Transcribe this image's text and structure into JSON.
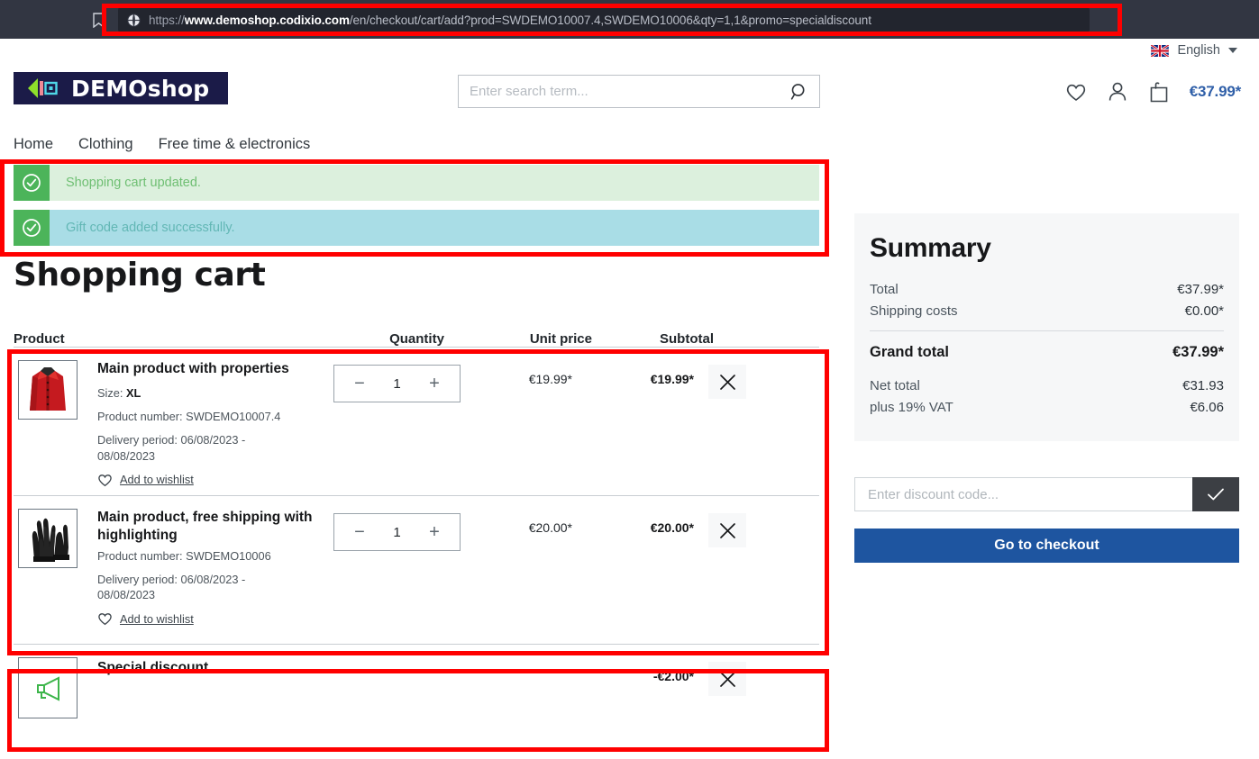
{
  "browser": {
    "bookmark_icon": "bookmark-icon",
    "site_icon": "globe-icon",
    "url_scheme": "https://",
    "url_host": "www.demoshop.codixio.com",
    "url_path": "/en/checkout/cart/add?prod=SWDEMO10007.4,SWDEMO10006&qty=1,1&promo=specialdiscount"
  },
  "header": {
    "language": {
      "flag_icon": "uk-flag-icon",
      "label": "English",
      "caret_icon": "chevron-down-icon"
    },
    "logo": {
      "text": "DEMOshop",
      "mark_icon": "chevron-left-logo-icon"
    },
    "search": {
      "placeholder": "Enter search term...",
      "value": "",
      "icon": "search-icon"
    },
    "actions": {
      "wishlist_icon": "heart-icon",
      "account_icon": "person-icon",
      "cart_icon": "shopping-bag-icon",
      "cart_total": "€37.99*"
    },
    "nav": [
      {
        "label": "Home"
      },
      {
        "label": "Clothing"
      },
      {
        "label": "Free time & electronics"
      }
    ]
  },
  "alerts": [
    {
      "type": "success",
      "icon": "check-circle-icon",
      "text": "Shopping cart updated."
    },
    {
      "type": "info",
      "icon": "check-circle-icon",
      "text": "Gift code added successfully."
    }
  ],
  "page": {
    "title": "Shopping cart"
  },
  "cart": {
    "columns": {
      "product": "Product",
      "quantity": "Quantity",
      "unit_price": "Unit price",
      "subtotal": "Subtotal"
    },
    "items": [
      {
        "thumb_icon": "red-shirt-thumbnail",
        "name": "Main product with properties",
        "variant_label": "Size:",
        "variant_value": "XL",
        "product_number": "Product number: SWDEMO10007.4",
        "delivery_period": "Delivery period: 06/08/2023 - 08/08/2023",
        "wishlist_label": "Add to wishlist",
        "wishlist_icon": "heart-icon",
        "quantity": "1",
        "decrement_label": "−",
        "increment_label": "+",
        "unit_price": "€19.99*",
        "subtotal": "€19.99*",
        "remove_icon": "close-icon"
      },
      {
        "thumb_icon": "black-gloves-thumbnail",
        "name": "Main product, free shipping with highlighting",
        "variant_label": "",
        "variant_value": "",
        "product_number": "Product number: SWDEMO10006",
        "delivery_period": "Delivery period: 06/08/2023 - 08/08/2023",
        "wishlist_label": "Add to wishlist",
        "wishlist_icon": "heart-icon",
        "quantity": "1",
        "decrement_label": "−",
        "increment_label": "+",
        "unit_price": "€20.00*",
        "subtotal": "€20.00*",
        "remove_icon": "close-icon"
      }
    ],
    "discount": {
      "icon": "megaphone-icon",
      "name": "Special discount",
      "subtotal": "-€2.00*",
      "remove_icon": "close-icon"
    }
  },
  "summary": {
    "title": "Summary",
    "lines": [
      {
        "label": "Total",
        "value": "€37.99*"
      },
      {
        "label": "Shipping costs",
        "value": "€0.00*"
      }
    ],
    "grand": {
      "label": "Grand total",
      "value": "€37.99*"
    },
    "tax_lines": [
      {
        "label": "Net total",
        "value": "€31.93"
      },
      {
        "label": "plus 19% VAT",
        "value": "€6.06"
      }
    ]
  },
  "discount_form": {
    "placeholder": "Enter discount code...",
    "value": "",
    "submit_icon": "check-icon"
  },
  "checkout": {
    "label": "Go to checkout"
  },
  "colors": {
    "brand_navy": "#1b1b48",
    "accent_blue": "#1e55a0",
    "cart_total_blue": "#2f5fa8",
    "alert_success_bg": "#dcf0dd",
    "alert_info_bg": "#a9dde6",
    "alert_icon_green": "#4cb45a",
    "annotation_red": "#ff0000",
    "summary_bg": "#f6f7f8",
    "urlbar_bg": "#323642"
  }
}
